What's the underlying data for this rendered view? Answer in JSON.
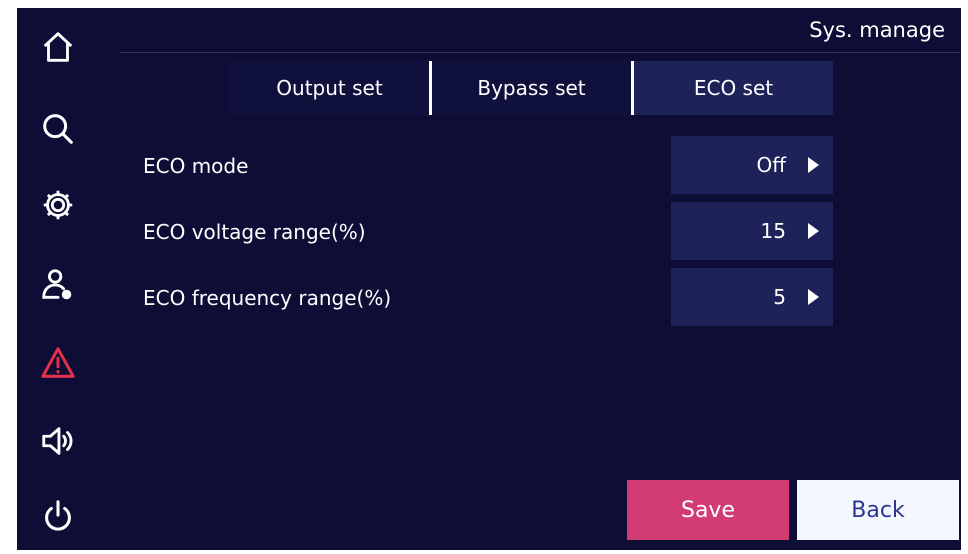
{
  "header": {
    "title": "Sys. manage"
  },
  "sidebar": {
    "icons": [
      {
        "name": "home-icon",
        "color": "#ffffff"
      },
      {
        "name": "search-icon",
        "color": "#ffffff"
      },
      {
        "name": "gear-icon",
        "color": "#ffffff"
      },
      {
        "name": "user-settings-icon",
        "color": "#ffffff"
      },
      {
        "name": "warning-icon",
        "color": "#e0304a"
      },
      {
        "name": "speaker-icon",
        "color": "#ffffff"
      },
      {
        "name": "power-icon",
        "color": "#ffffff"
      }
    ]
  },
  "tabs": [
    {
      "label": "Output set",
      "active": false
    },
    {
      "label": "Bypass set",
      "active": false
    },
    {
      "label": "ECO set",
      "active": true
    }
  ],
  "settings": [
    {
      "label": "ECO mode",
      "value": "Off"
    },
    {
      "label": "ECO voltage range(%)",
      "value": "15"
    },
    {
      "label": "ECO frequency range(%)",
      "value": "5"
    }
  ],
  "buttons": {
    "save": "Save",
    "back": "Back"
  },
  "colors": {
    "background": "#0d0d36",
    "value_box": "#1d2259",
    "save": "#d13c73",
    "back": "#f5f7ff",
    "back_text": "#2b3590",
    "alert": "#e0304a"
  }
}
